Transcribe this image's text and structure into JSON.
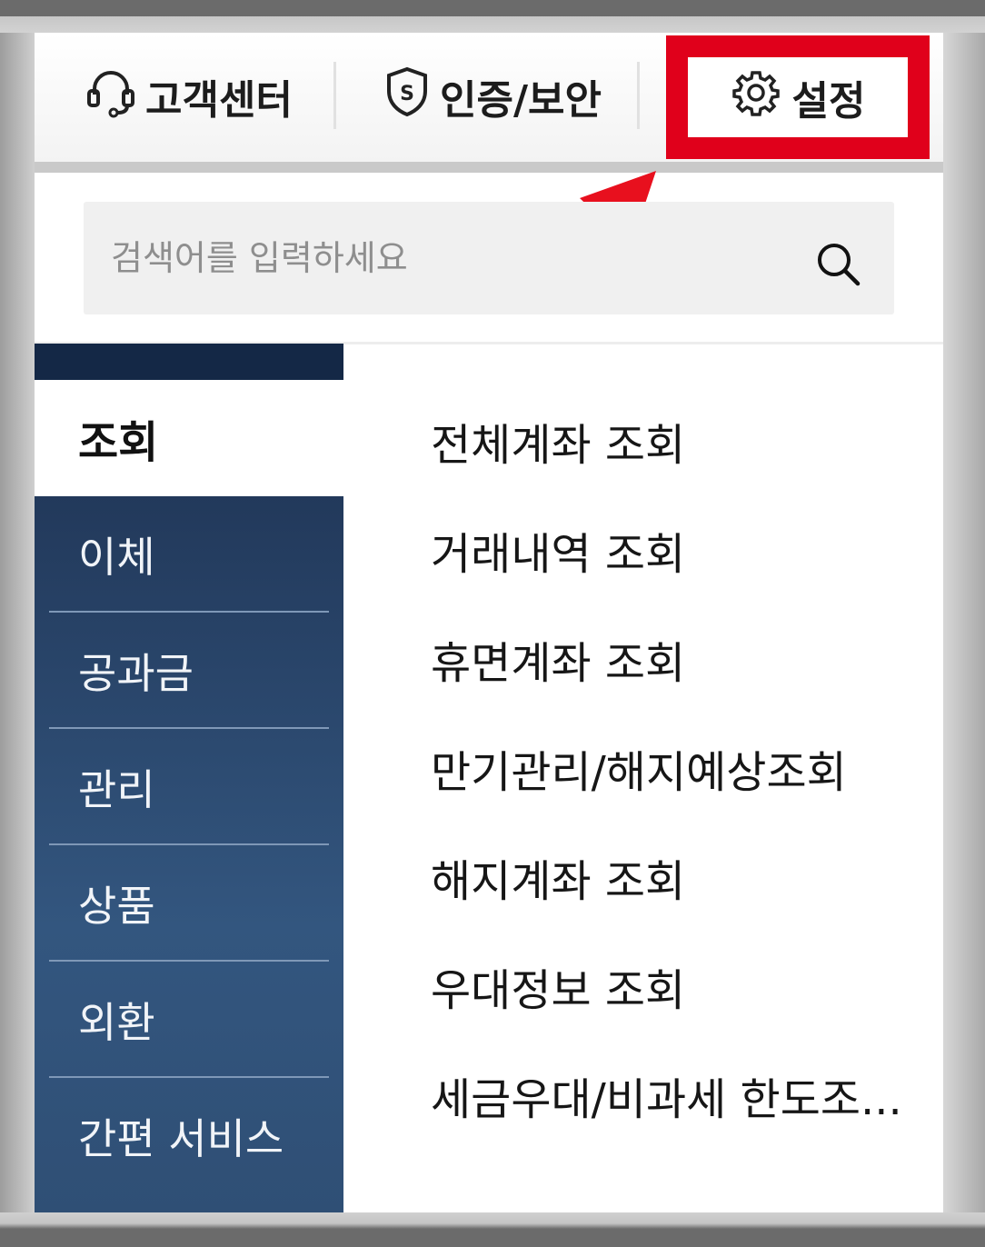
{
  "header": {
    "customer_center_label": "고객센터",
    "security_label": "인증/보안",
    "settings_label": "설정",
    "highlight_color": "#e0001b"
  },
  "search": {
    "placeholder": "검색어를 입력하세요"
  },
  "nav": {
    "active_label": "조회",
    "items": [
      {
        "label": "이체"
      },
      {
        "label": "공과금"
      },
      {
        "label": "관리"
      },
      {
        "label": "상품"
      },
      {
        "label": "외환"
      },
      {
        "label": "간편 서비스"
      }
    ],
    "nav_color": "#2b4a70"
  },
  "submenu": {
    "items": [
      {
        "label": "전체계좌 조회"
      },
      {
        "label": "거래내역 조회"
      },
      {
        "label": "휴면계좌 조회"
      },
      {
        "label": "만기관리/해지예상조회"
      },
      {
        "label": "해지계좌 조회"
      },
      {
        "label": "우대정보 조회"
      },
      {
        "label": "세금우대/비과세 한도조..."
      }
    ]
  },
  "icons": {
    "customer_center": "headset-icon",
    "security": "shield-icon",
    "settings": "gear-icon",
    "search": "search-icon"
  }
}
